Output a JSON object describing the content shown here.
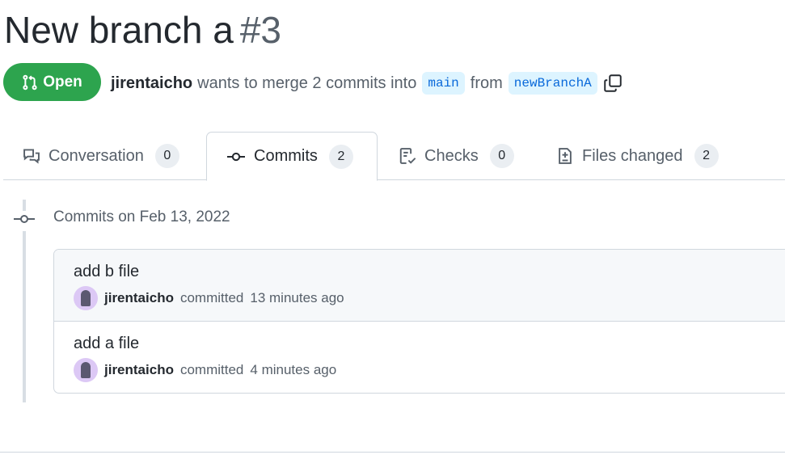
{
  "pr": {
    "title": "New branch a",
    "number": "#3",
    "state": "Open",
    "author": "jirentaicho",
    "merge_text": "wants to merge 2 commits into",
    "base": "main",
    "from_text": "from",
    "head": "newBranchA"
  },
  "tabs": [
    {
      "label": "Conversation",
      "count": "0"
    },
    {
      "label": "Commits",
      "count": "2"
    },
    {
      "label": "Checks",
      "count": "0"
    },
    {
      "label": "Files changed",
      "count": "2"
    }
  ],
  "commits": {
    "group_label": "Commits on Feb 13, 2022",
    "items": [
      {
        "message": "add b file",
        "author": "jirentaicho",
        "verb": "committed",
        "time": "13 minutes ago"
      },
      {
        "message": "add a file",
        "author": "jirentaicho",
        "verb": "committed",
        "time": "4 minutes ago"
      }
    ]
  },
  "colors": {
    "open": "#2da44e",
    "branch_bg": "#ddf4ff",
    "branch_fg": "#0969da"
  }
}
